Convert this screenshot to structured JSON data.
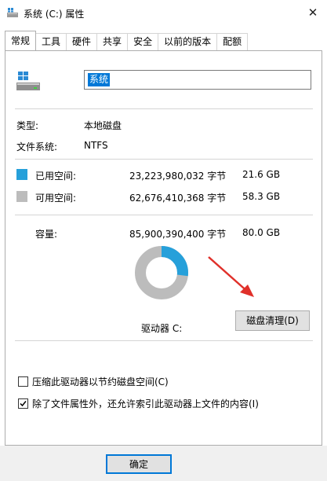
{
  "window": {
    "title": "系统 (C:) 属性",
    "close_symbol": "✕"
  },
  "tabs": [
    {
      "label": "常规",
      "active": true
    },
    {
      "label": "工具"
    },
    {
      "label": "硬件"
    },
    {
      "label": "共享"
    },
    {
      "label": "安全"
    },
    {
      "label": "以前的版本"
    },
    {
      "label": "配额"
    }
  ],
  "general": {
    "name_value": "系统",
    "type_label": "类型:",
    "type_value": "本地磁盘",
    "fs_label": "文件系统:",
    "fs_value": "NTFS",
    "used": {
      "label": "已用空间:",
      "bytes": "23,223,980,032 字节",
      "size": "21.6 GB",
      "color": "#26a0da"
    },
    "free": {
      "label": "可用空间:",
      "bytes": "62,676,410,368 字节",
      "size": "58.3 GB",
      "color": "#bcbcbc"
    },
    "capacity": {
      "label": "容量:",
      "bytes": "85,900,390,400 字节",
      "size": "80.0 GB"
    },
    "used_fraction": 0.27,
    "drive_label": "驱动器 C:",
    "cleanup_button": "磁盘清理(D)",
    "compress_option": {
      "label": "压缩此驱动器以节约磁盘空间(C)",
      "checked": false
    },
    "index_option": {
      "label": "除了文件属性外，还允许索引此驱动器上文件的内容(I)",
      "checked": true
    }
  },
  "footer": {
    "ok_label": "确定"
  }
}
